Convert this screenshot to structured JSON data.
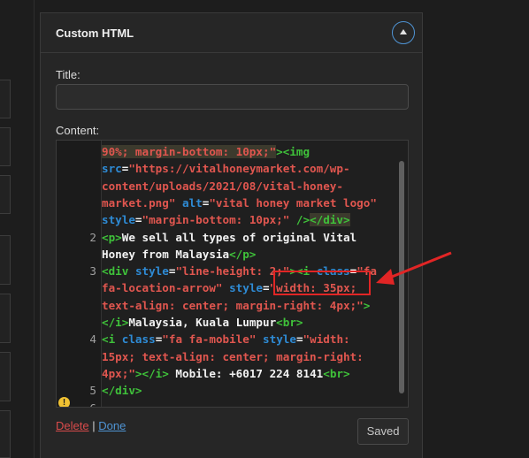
{
  "widget": {
    "title": "Custom HTML",
    "toggle_icon": "chevron-up-icon",
    "title_label": "Title:",
    "title_value": "",
    "content_label": "Content:"
  },
  "editor": {
    "lines": [
      {
        "ln": "",
        "segs": [
          [
            "str",
            "90%; margin-bottom: 10px;"
          ],
          [
            "str",
            "\""
          ],
          [
            "tag",
            ">"
          ],
          [
            "tag",
            "<img"
          ]
        ]
      },
      {
        "ln": "",
        "segs": [
          [
            "attr",
            "src"
          ],
          [
            "txt",
            "="
          ],
          [
            "str",
            "\"https://vitalhoneymarket.com/wp-"
          ]
        ]
      },
      {
        "ln": "",
        "segs": [
          [
            "str",
            "content/uploads/2021/08/vital-honey-"
          ]
        ]
      },
      {
        "ln": "",
        "segs": [
          [
            "str",
            "market.png\""
          ],
          [
            "txt",
            " "
          ],
          [
            "attr",
            "alt"
          ],
          [
            "txt",
            "="
          ],
          [
            "str",
            "\"vital honey market logo\""
          ]
        ]
      },
      {
        "ln": "",
        "segs": [
          [
            "attr",
            "style"
          ],
          [
            "txt",
            "="
          ],
          [
            "str",
            "\"margin-bottom: 10px;\""
          ],
          [
            "txt",
            " "
          ],
          [
            "tag",
            "/>"
          ],
          [
            "tag",
            "</div>"
          ]
        ]
      },
      {
        "ln": "2",
        "segs": [
          [
            "tag",
            "<p>"
          ],
          [
            "txt",
            "We sell all types of original Vital"
          ]
        ]
      },
      {
        "ln": "",
        "segs": [
          [
            "txt",
            "Honey from Malaysia"
          ],
          [
            "tag",
            "</p>"
          ]
        ]
      },
      {
        "ln": "3",
        "segs": [
          [
            "tag",
            "<div"
          ],
          [
            "txt",
            " "
          ],
          [
            "attr",
            "style"
          ],
          [
            "txt",
            "="
          ],
          [
            "str",
            "\"line-height: 2;\""
          ],
          [
            "tag",
            "><i"
          ],
          [
            "txt",
            " "
          ],
          [
            "attr",
            "class"
          ],
          [
            "txt",
            "="
          ],
          [
            "str",
            "\"fa"
          ]
        ]
      },
      {
        "ln": "",
        "segs": [
          [
            "str",
            "fa-location-arrow\""
          ],
          [
            "txt",
            " "
          ],
          [
            "attr",
            "style"
          ],
          [
            "txt",
            "="
          ],
          [
            "str",
            "\"width: 35px;"
          ]
        ]
      },
      {
        "ln": "",
        "segs": [
          [
            "str",
            "text-align: center; margin-right: 4px;\""
          ],
          [
            "tag",
            ">"
          ]
        ]
      },
      {
        "ln": "",
        "segs": [
          [
            "tag",
            "</i>"
          ],
          [
            "txt",
            "Malaysia, Kuala Lumpur"
          ],
          [
            "tag",
            "<br>"
          ]
        ]
      },
      {
        "ln": "4",
        "segs": [
          [
            "tag",
            "<i"
          ],
          [
            "txt",
            " "
          ],
          [
            "attr",
            "class"
          ],
          [
            "txt",
            "="
          ],
          [
            "str",
            "\"fa fa-mobile\""
          ],
          [
            "txt",
            " "
          ],
          [
            "attr",
            "style"
          ],
          [
            "txt",
            "="
          ],
          [
            "str",
            "\"width:"
          ]
        ]
      },
      {
        "ln": "",
        "segs": [
          [
            "str",
            "15px; text-align: center; margin-right:"
          ]
        ]
      },
      {
        "ln": "",
        "segs": [
          [
            "str",
            "4px;\""
          ],
          [
            "tag",
            "></i>"
          ],
          [
            "txt",
            " Mobile: +6017 224 8141"
          ],
          [
            "tag",
            "<br>"
          ]
        ]
      },
      {
        "ln": "5",
        "segs": [
          [
            "tag",
            "</div>"
          ]
        ]
      },
      {
        "ln": "6",
        "segs": []
      }
    ]
  },
  "actions": {
    "delete_label": "Delete",
    "separator": "|",
    "done_label": "Done",
    "saved_label": "Saved"
  },
  "annotation": {
    "box_color": "#e12525",
    "arrow_color": "#e12525"
  }
}
